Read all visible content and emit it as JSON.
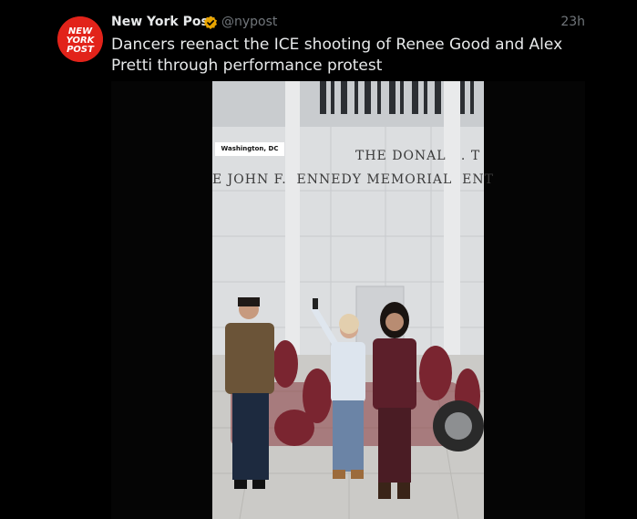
{
  "post": {
    "account_name": "New York Post",
    "handle": "@nypost",
    "timestamp": "23h",
    "text": "Dancers reenact the ICE shooting of Renee Good and Alex Pretti through performance protest",
    "verified": true,
    "avatar_logo": "NEW YORK POST"
  },
  "media": {
    "location_label": "Washington, DC",
    "sign_line_1": "THE DONAL   . T",
    "sign_line_2": "E JOHN F.  ENNEDY MEMORIAL  ENT"
  },
  "colors": {
    "background": "#000000",
    "primary_text": "#e7e9ea",
    "secondary_text": "#71767b",
    "verified_badge": "#e8a400",
    "avatar_red": "#e2231a"
  },
  "icons": {
    "verified": "gold-verified-badge-icon"
  }
}
